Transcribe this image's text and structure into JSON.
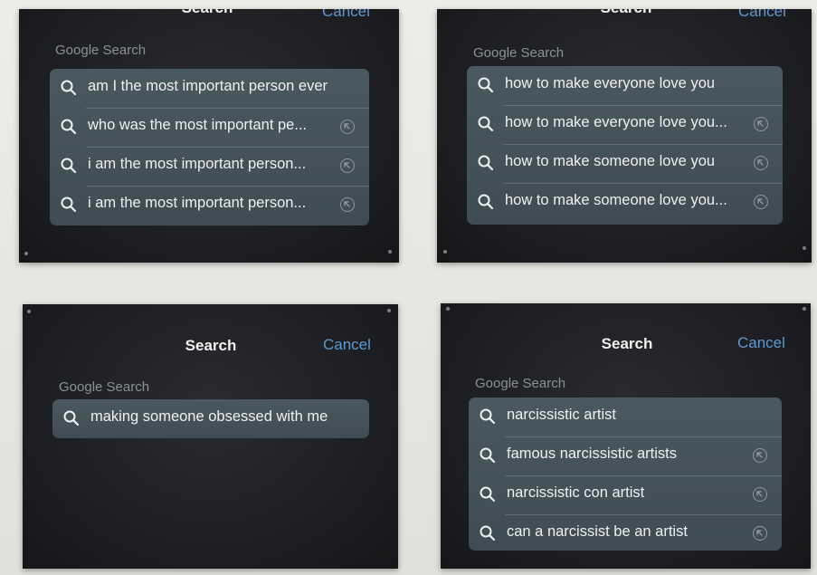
{
  "panels": [
    {
      "header": {
        "title": "Search",
        "cancel": "Cancel"
      },
      "section": "Google Search",
      "results": [
        {
          "text": "am I the most important person ever",
          "icon": "search-icon",
          "arrow": false
        },
        {
          "text": "who was the most important pe...",
          "icon": "search-icon",
          "arrow": true
        },
        {
          "text": "i am the most important person...",
          "icon": "search-icon",
          "arrow": true
        },
        {
          "text": "i am the most important person...",
          "icon": "search-icon",
          "arrow": true
        }
      ]
    },
    {
      "header": {
        "title": "Search",
        "cancel": "Cancel"
      },
      "section": "Google Search",
      "results": [
        {
          "text": "how to make everyone love you",
          "icon": "search-icon",
          "arrow": false
        },
        {
          "text": "how to make everyone love you...",
          "icon": "search-icon",
          "arrow": true
        },
        {
          "text": "how to make someone love you",
          "icon": "search-icon",
          "arrow": true
        },
        {
          "text": "how to make someone love you...",
          "icon": "search-icon",
          "arrow": true
        }
      ]
    },
    {
      "header": {
        "title": "Search",
        "cancel": "Cancel"
      },
      "section": "Google Search",
      "results": [
        {
          "text": "making someone obsessed with me",
          "icon": "search-icon",
          "arrow": false
        }
      ]
    },
    {
      "header": {
        "title": "Search",
        "cancel": "Cancel"
      },
      "section": "Google Search",
      "results": [
        {
          "text": "narcissistic artist",
          "icon": "search-icon",
          "arrow": false
        },
        {
          "text": "famous narcissistic artists",
          "icon": "search-icon",
          "arrow": true
        },
        {
          "text": "narcissistic con artist",
          "icon": "search-icon",
          "arrow": true
        },
        {
          "text": "can a narcissist be an artist",
          "icon": "search-icon",
          "arrow": true
        }
      ]
    }
  ],
  "colors": {
    "wall": "#e6e4df",
    "panel": "#1c1d20",
    "list_bg": "#45535b",
    "accent_cancel": "#5f98cf",
    "section_label": "#8c9094"
  }
}
